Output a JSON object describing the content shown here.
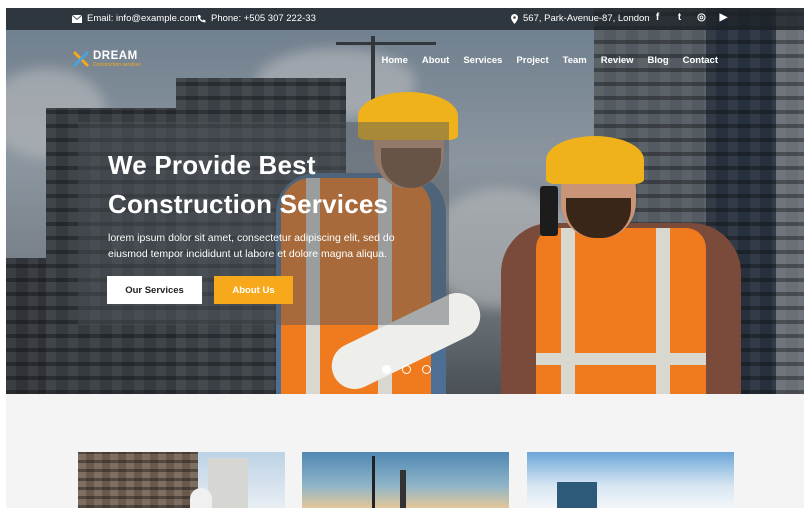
{
  "topbar": {
    "email": "Email: info@example.com",
    "phone": "Phone: +505 307 222-33",
    "address": "567, Park-Avenue-87, London",
    "social": [
      {
        "icon": "facebook-icon",
        "glyph": "f"
      },
      {
        "icon": "twitter-icon",
        "glyph": "t"
      },
      {
        "icon": "instagram-icon",
        "glyph": "◎"
      },
      {
        "icon": "youtube-icon",
        "glyph": "▶"
      }
    ]
  },
  "logo": {
    "main": "DREAM",
    "sub": "Construction services"
  },
  "nav": {
    "items": [
      "Home",
      "About",
      "Services",
      "Project",
      "Team",
      "Review",
      "Blog",
      "Contact"
    ]
  },
  "hero": {
    "title": "We Provide Best Construction Services",
    "text": "lorem ipsum dolor sit amet, consectetur adipiscing elit, sed do eiusmod tempor incididunt ut labore et dolore magna aliqua.",
    "primary_button": "Our Services",
    "secondary_button": "About Us",
    "slides_total": 3,
    "slide_active": 1
  },
  "colors": {
    "accent": "#f7a81b",
    "topbar_bg": "#1e2228",
    "vest": "#f07a1e",
    "helmet": "#f0b21a"
  }
}
